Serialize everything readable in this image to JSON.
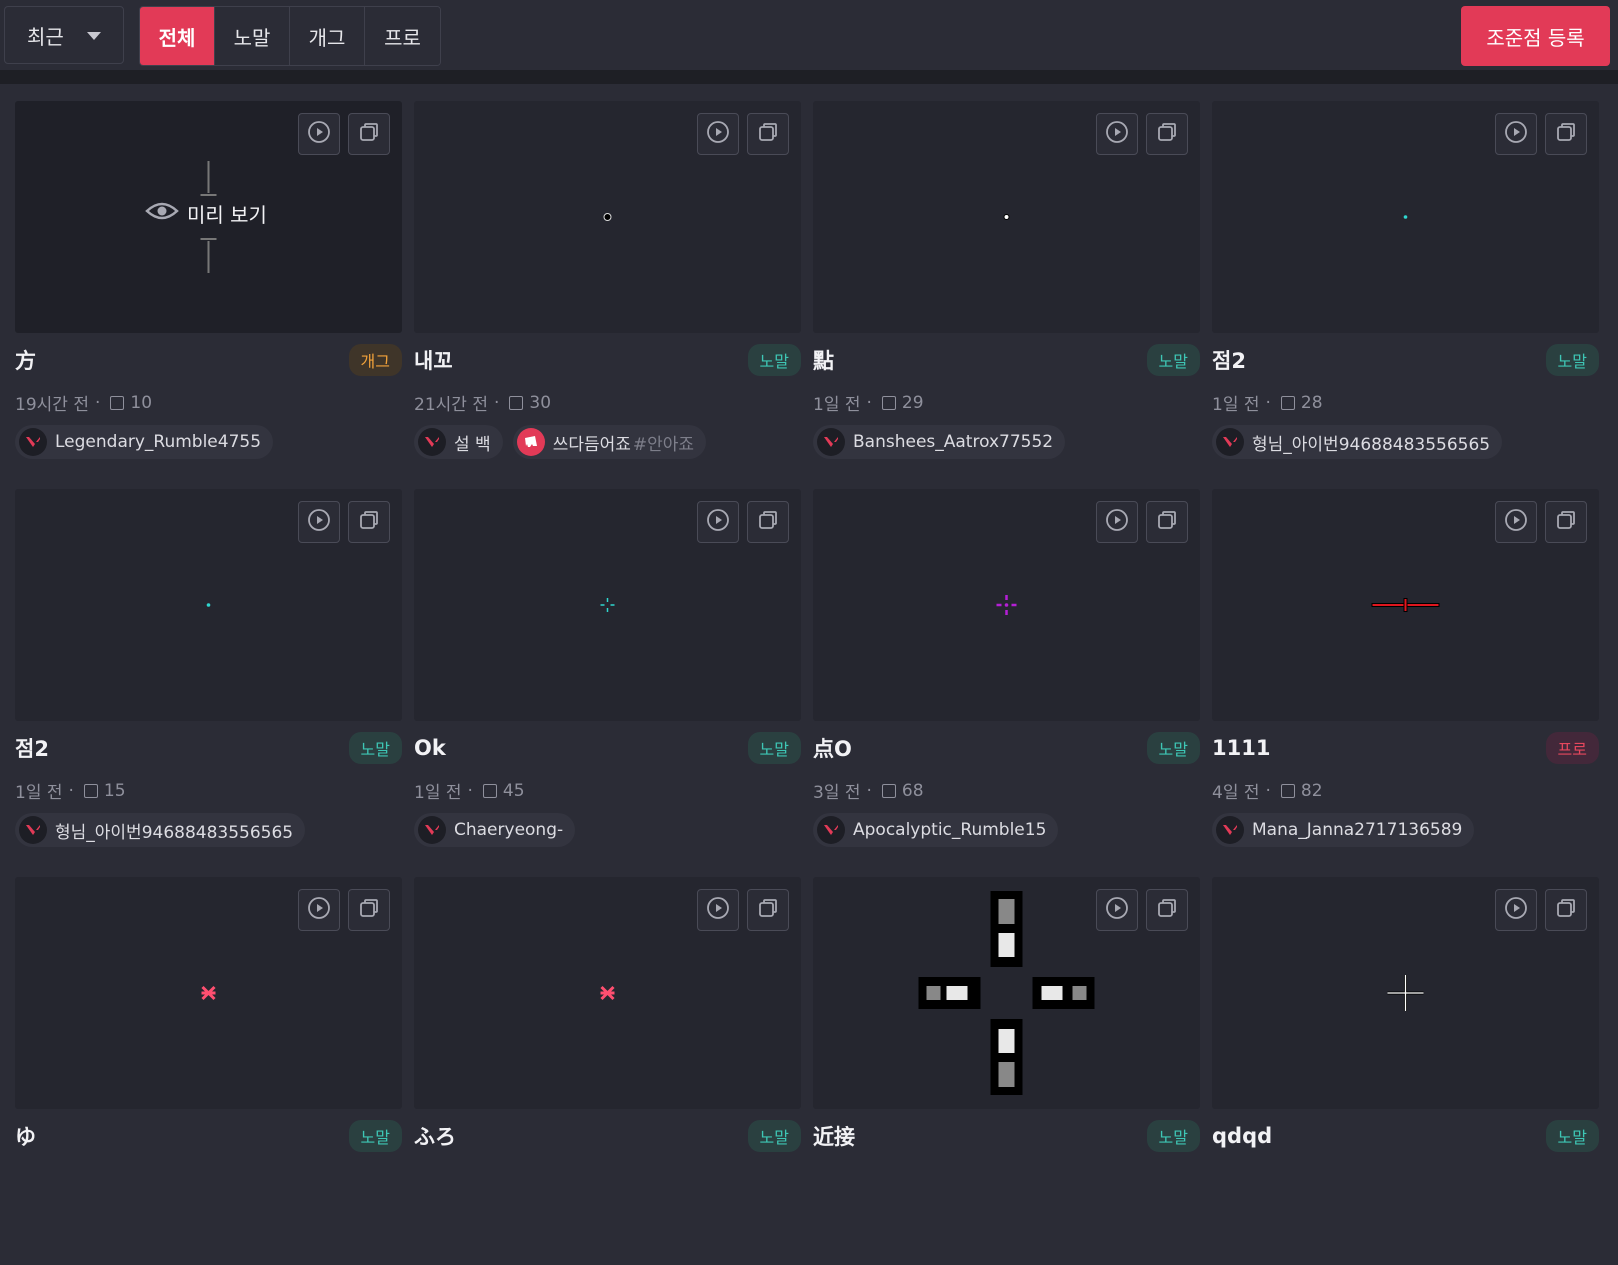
{
  "topbar": {
    "sort": "최근",
    "tabs": [
      "전체",
      "노말",
      "개그",
      "프로"
    ],
    "active_tab": "전체",
    "register_button": "조준점 등록"
  },
  "preview_label": "미리 보기",
  "colors": {
    "accent": "#e23a57",
    "normal": "#3ec6b5",
    "gag": "#f2a23a",
    "pro": "#e5475d"
  },
  "cards": [
    {
      "title": "方",
      "badge": "개그",
      "badge_type": "gag",
      "time": "19시간 전",
      "copies": "10",
      "users": [
        {
          "name": "Legendary_Rumble4755",
          "tag": "",
          "icon": "valorant-icon"
        }
      ],
      "crosshair": "preview-hover"
    },
    {
      "title": "내꼬",
      "badge": "노말",
      "badge_type": "normal",
      "time": "21시간 전",
      "copies": "30",
      "users": [
        {
          "name": "설 백",
          "tag": "",
          "icon": "valorant-icon"
        },
        {
          "name": "쓰다듬어죠",
          "tag": "#안아죠",
          "icon": "riot-icon"
        }
      ],
      "crosshair": "dot-black"
    },
    {
      "title": "點",
      "badge": "노말",
      "badge_type": "normal",
      "time": "1일 전",
      "copies": "29",
      "users": [
        {
          "name": "Banshees_Aatrox77552",
          "tag": "",
          "icon": "valorant-icon"
        }
      ],
      "crosshair": "dot-white"
    },
    {
      "title": "점2",
      "badge": "노말",
      "badge_type": "normal",
      "time": "1일 전",
      "copies": "28",
      "users": [
        {
          "name": "형님_아이번94688483556565",
          "tag": "",
          "icon": "valorant-icon"
        }
      ],
      "crosshair": "dot-cyan"
    },
    {
      "title": "점2",
      "badge": "노말",
      "badge_type": "normal",
      "time": "1일 전",
      "copies": "15",
      "users": [
        {
          "name": "형님_아이번94688483556565",
          "tag": "",
          "icon": "valorant-icon"
        }
      ],
      "crosshair": "dot-cyan"
    },
    {
      "title": "Ok",
      "badge": "노말",
      "badge_type": "normal",
      "time": "1일 전",
      "copies": "45",
      "users": [
        {
          "name": "Chaeryeong-",
          "tag": "",
          "icon": "valorant-icon"
        }
      ],
      "crosshair": "cross-cyan"
    },
    {
      "title": "点O",
      "badge": "노말",
      "badge_type": "normal",
      "time": "3일 전",
      "copies": "68",
      "users": [
        {
          "name": "Apocalyptic_Rumble15",
          "tag": "",
          "icon": "valorant-icon"
        }
      ],
      "crosshair": "cross-purple"
    },
    {
      "title": "1111",
      "badge": "프로",
      "badge_type": "pro",
      "time": "4일 전",
      "copies": "82",
      "users": [
        {
          "name": "Mana_Janna2717136589",
          "tag": "",
          "icon": "valorant-icon"
        }
      ],
      "crosshair": "line-red"
    },
    {
      "title": "ゆ",
      "badge": "노말",
      "badge_type": "normal",
      "time": "",
      "copies": "",
      "users": [],
      "crosshair": "x-pink"
    },
    {
      "title": "ふろ",
      "badge": "노말",
      "badge_type": "normal",
      "time": "",
      "copies": "",
      "users": [],
      "crosshair": "x-pink"
    },
    {
      "title": "近接",
      "badge": "노말",
      "badge_type": "normal",
      "time": "",
      "copies": "",
      "users": [],
      "crosshair": "big-blocks"
    },
    {
      "title": "qdqd",
      "badge": "노말",
      "badge_type": "normal",
      "time": "",
      "copies": "",
      "users": [],
      "crosshair": "plus-white"
    }
  ]
}
